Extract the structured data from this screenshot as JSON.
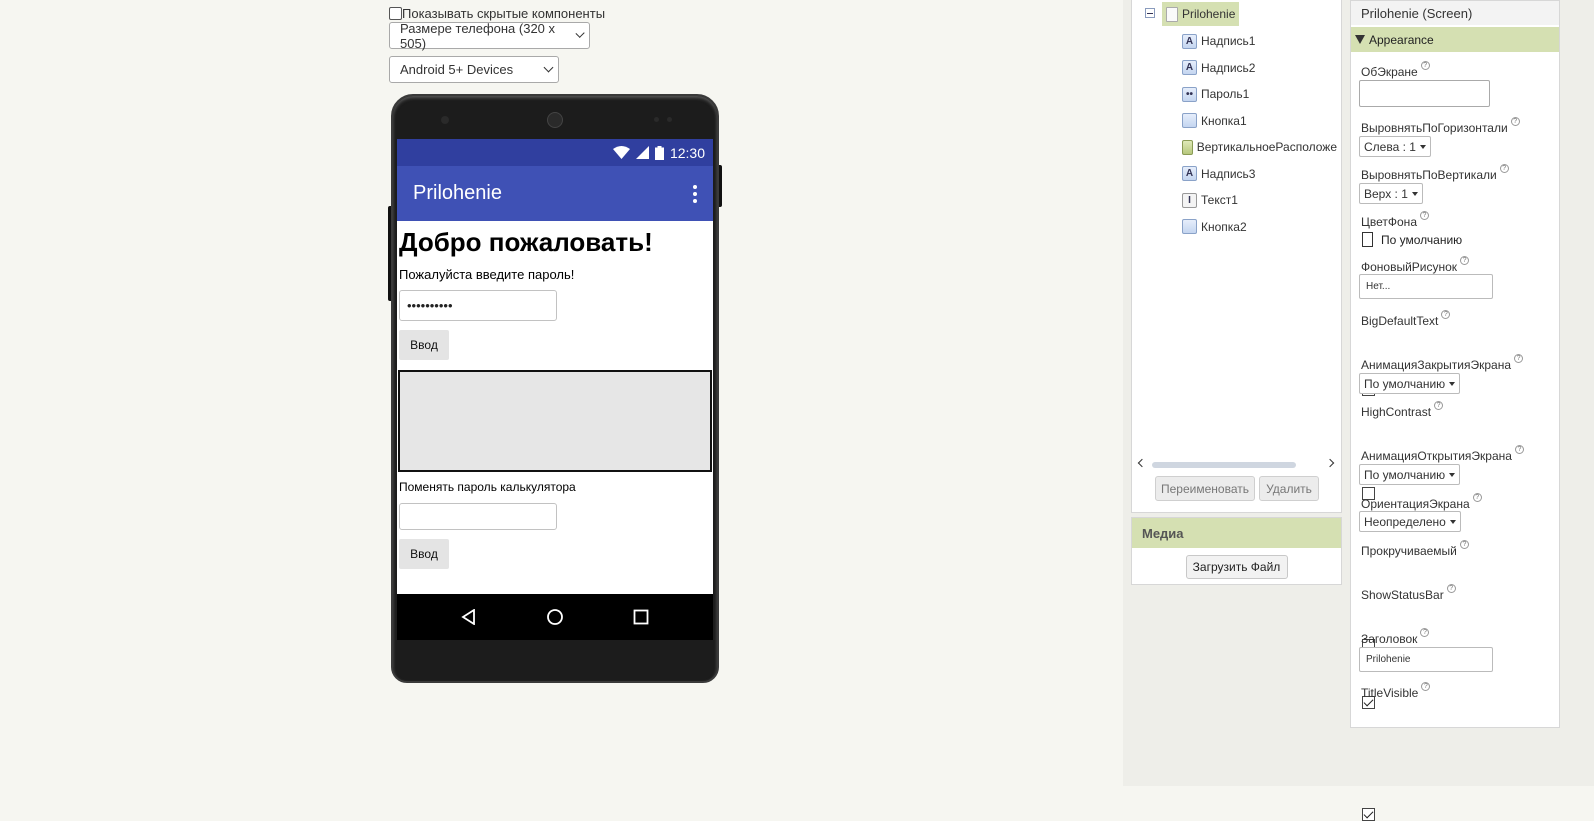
{
  "toolbar": {
    "hidden_components_label": "Показывать скрытые компоненты",
    "size_select": "Размере телефона (320 x 505)",
    "device_select": "Android 5+ Devices"
  },
  "phone": {
    "status_time": "12:30",
    "app_title": "Prilohenie",
    "welcome": "Добро пожаловать!",
    "prompt": "Пожалуйста введите пароль!",
    "password_value": "••••••••••",
    "enter_button": "Ввод",
    "change_label": "Поменять пароль калькулятора",
    "enter_button_2": "Ввод"
  },
  "tree": {
    "root": "Prilohenie",
    "items": [
      {
        "label": "Надпись1",
        "icon": "label-icon"
      },
      {
        "label": "Надпись2",
        "icon": "label-icon"
      },
      {
        "label": "Пароль1",
        "icon": "password-icon"
      },
      {
        "label": "Кнопка1",
        "icon": "button-icon"
      },
      {
        "label": "ВертикальноеРасположе",
        "icon": "vertical-arrangement-icon"
      },
      {
        "label": "Надпись3",
        "icon": "label-icon"
      },
      {
        "label": "Текст1",
        "icon": "textbox-icon"
      },
      {
        "label": "Кнопка2",
        "icon": "button-icon"
      }
    ],
    "rename_button": "Переименовать",
    "delete_button": "Удалить"
  },
  "media": {
    "title": "Медиа",
    "upload_button": "Загрузить Файл"
  },
  "properties": {
    "title": "Prilohenie (Screen)",
    "section": "Appearance",
    "about_label": "ОбЭкране",
    "halign_label": "ВыровнятьПоГоризонтали",
    "halign_value": "Слева : 1",
    "valign_label": "ВыровнятьПоВертикали",
    "valign_value": "Верх : 1",
    "bgcolor_label": "ЦветФона",
    "bgcolor_value": "По умолчанию",
    "bgimage_label": "ФоновыйРисунок",
    "bgimage_value": "Нет...",
    "bigtext_label": "BigDefaultText",
    "closeanim_label": "АнимацияЗакрытияЭкрана",
    "closeanim_value": "По умолчанию",
    "highcontrast_label": "HighContrast",
    "openanim_label": "АнимацияОткрытияЭкрана",
    "openanim_value": "По умолчанию",
    "orientation_label": "ОриентацияЭкрана",
    "orientation_value": "Неопределено",
    "scrollable_label": "Прокручиваемый",
    "statusbar_label": "ShowStatusBar",
    "title_label": "Заголовок",
    "title_value": "Prilohenie",
    "titlevisible_label": "TitleVisible"
  },
  "colors": {
    "status_bar": "#303f9f",
    "app_bar": "#3f51b5",
    "section_header": "#d5e0b2"
  }
}
